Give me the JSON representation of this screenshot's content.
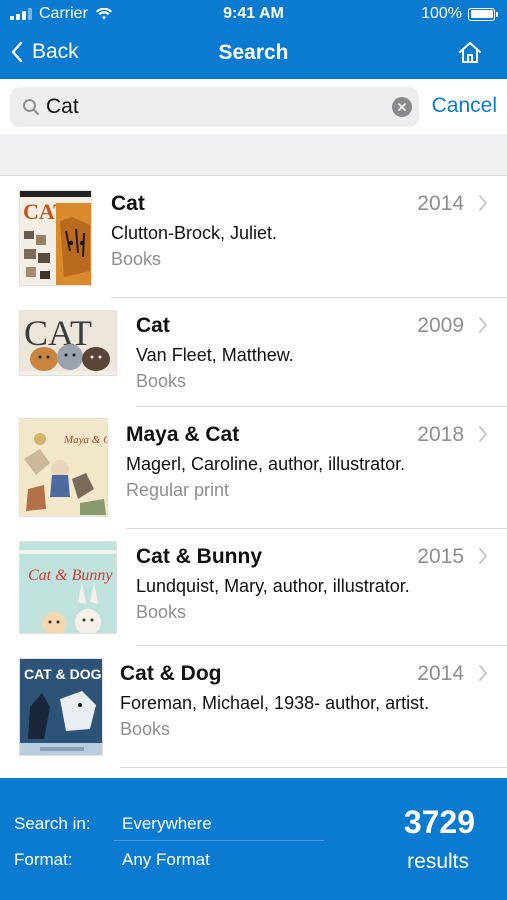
{
  "status_bar": {
    "carrier": "Carrier",
    "time": "9:41 AM",
    "battery": "100%"
  },
  "nav": {
    "back_label": "Back",
    "title": "Search",
    "home_icon": "home-icon"
  },
  "search": {
    "value": "Cat",
    "placeholder": "",
    "cancel_label": "Cancel"
  },
  "results": [
    {
      "title": "Cat",
      "author": "Clutton-Brock, Juliet.",
      "format": "Books",
      "year": "2014",
      "cover_text": "CAT"
    },
    {
      "title": "Cat",
      "author": "Van Fleet, Matthew.",
      "format": "Books",
      "year": "2009",
      "cover_text": "CAT"
    },
    {
      "title": "Maya & Cat",
      "author": "Magerl, Caroline, author, illustrator.",
      "format": "Regular print",
      "year": "2018",
      "cover_text": "Maya & Cat"
    },
    {
      "title": "Cat & Bunny",
      "author": "Lundquist, Mary, author, illustrator.",
      "format": "Books",
      "year": "2015",
      "cover_text": "Cat & Bunny"
    },
    {
      "title": "Cat & Dog",
      "author": "Foreman, Michael, 1938- author, artist.",
      "format": "Books",
      "year": "2014",
      "cover_text": "CAT & DOG"
    }
  ],
  "filters": {
    "search_in_label": "Search in:",
    "search_in_value": "Everywhere",
    "format_label": "Format:",
    "format_value": "Any Format",
    "count": "3729",
    "count_label": "results"
  },
  "colors": {
    "brand": "#0a7bd0",
    "muted": "#8e8e93"
  }
}
